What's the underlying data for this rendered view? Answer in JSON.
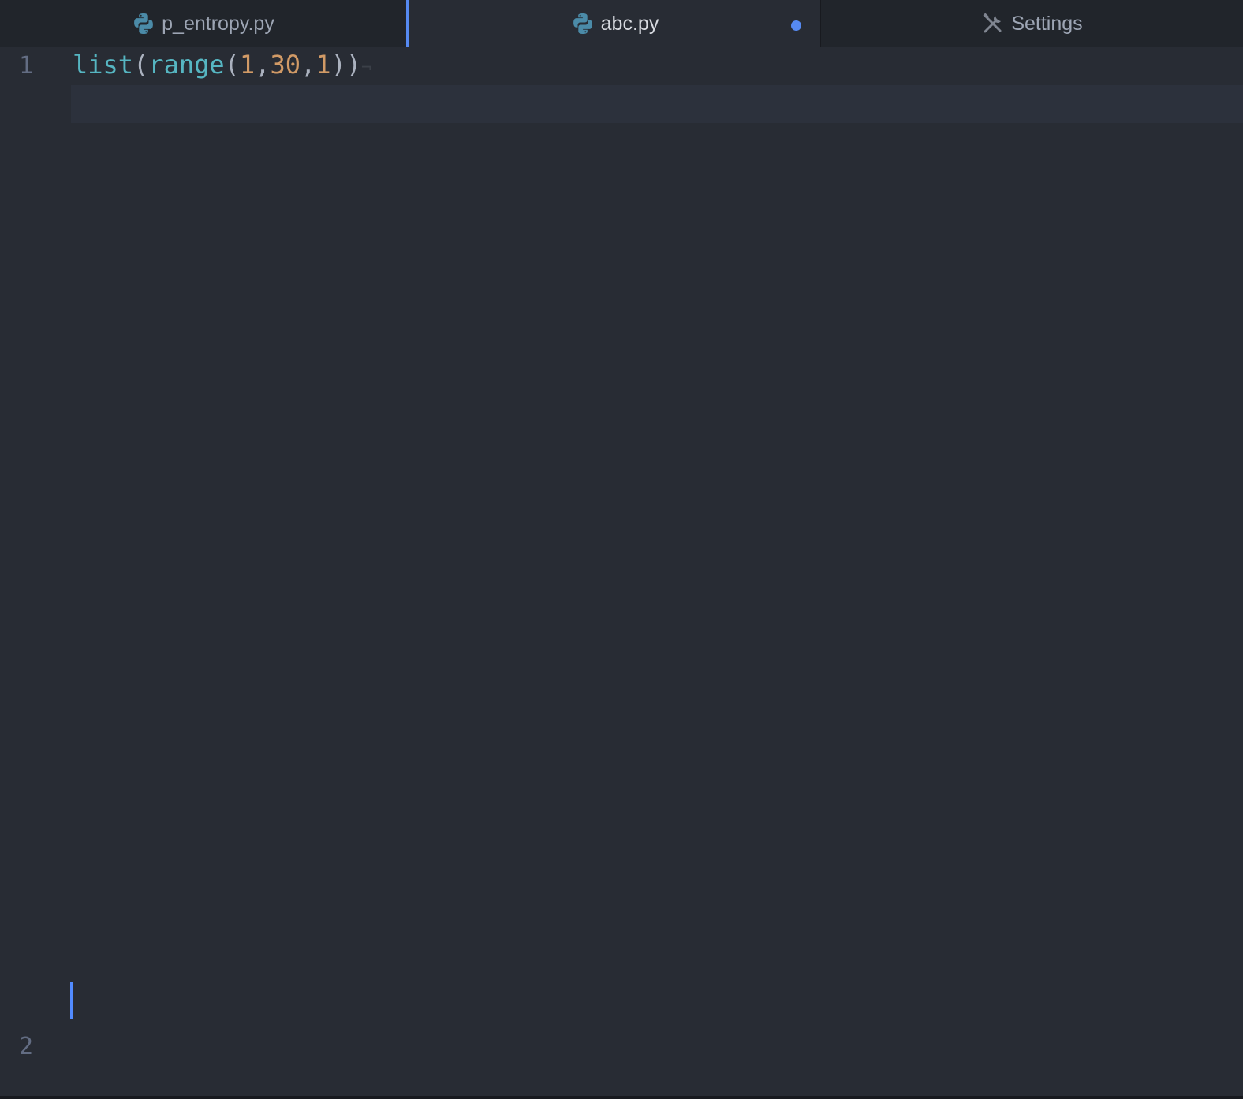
{
  "tabs": [
    {
      "label": "p_entropy.py",
      "icon": "python-icon"
    },
    {
      "label": "abc.py",
      "icon": "python-icon",
      "modified": true
    },
    {
      "label": "Settings",
      "icon": "tools-icon"
    }
  ],
  "editor": {
    "line_numbers": [
      "1",
      "2"
    ],
    "code": {
      "line1": {
        "fn1": "list",
        "p1": "(",
        "fn2": "range",
        "p2": "(",
        "n1": "1",
        "c1": ",",
        "n2": "30",
        "c2": ",",
        "n3": "1",
        "p3": "))",
        "eol": "¬"
      }
    }
  },
  "colors": {
    "accent": "#568af2",
    "python_icon": "#4b8ba8",
    "function": "#56b6c2",
    "number": "#d19a66"
  }
}
